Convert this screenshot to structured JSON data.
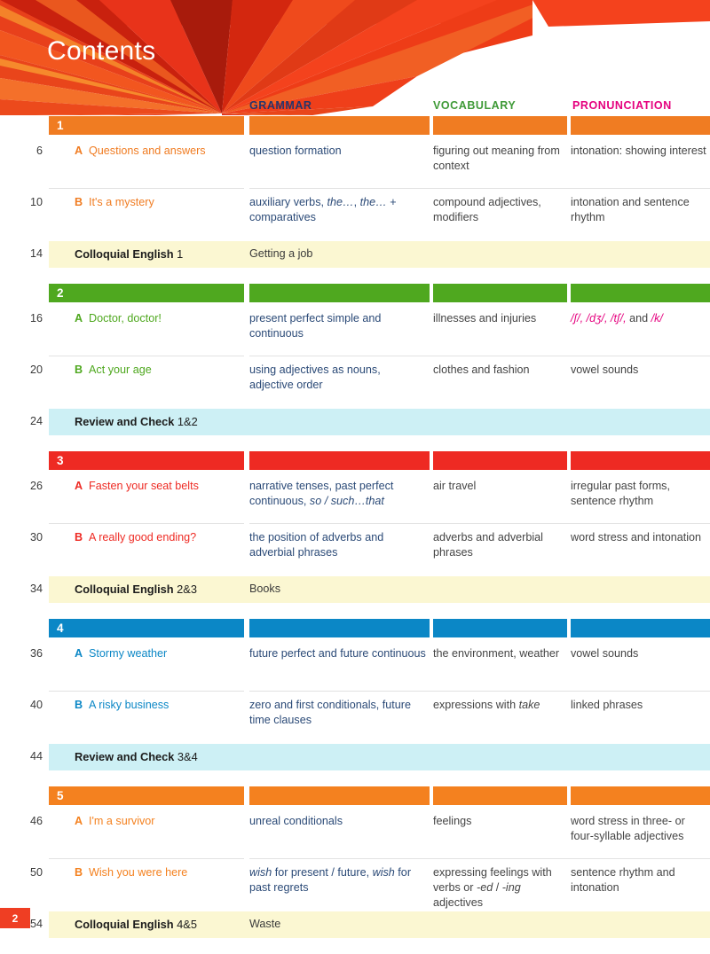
{
  "page": {
    "title": "Contents",
    "page_number": "2",
    "accent_red": "#ef3e23",
    "title_band_color": "#f4421d"
  },
  "columns": [
    {
      "label": "GRAMMAR",
      "color": "#26356b"
    },
    {
      "label": "VOCABULARY",
      "color": "#3f9a37"
    },
    {
      "label": "PRONUNCIATION",
      "color": "#e5007e"
    }
  ],
  "units": [
    {
      "number": "1",
      "color": "#f07c22",
      "lessons": [
        {
          "page": "6",
          "letter": "A",
          "title": "Questions and answers",
          "grammar": "question formation",
          "vocabulary": "figuring out meaning from context",
          "pronunciation": "intonation: showing interest"
        },
        {
          "page": "10",
          "letter": "B",
          "title": "It's a mystery",
          "grammar": "auxiliary verbs, <i>the…</i>, <i>the…</i> + comparatives",
          "vocabulary": "compound adjectives, modifiers",
          "pronunciation": "intonation and sentence rhythm"
        }
      ],
      "special": {
        "page": "14",
        "label": "<b>Colloquial English</b> 1",
        "extra": "Getting a job",
        "color": "#fbf7d2"
      }
    },
    {
      "number": "2",
      "color": "#4fa81f",
      "lessons": [
        {
          "page": "16",
          "letter": "A",
          "title": "Doctor, doctor!",
          "grammar": "present perfect simple and continuous",
          "vocabulary": "illnesses and injuries",
          "pronunciation": "<i style=\"color:#e5007e\">/ʃ/, /dʒ/, /tʃ/,</i> and <i style=\"color:#e5007e\">/k/</i>"
        },
        {
          "page": "20",
          "letter": "B",
          "title": "Act your age",
          "grammar": "using adjectives as nouns, adjective order",
          "vocabulary": "clothes and fashion",
          "pronunciation": "vowel sounds"
        }
      ],
      "special": {
        "page": "24",
        "label": "<b>Review and Check</b> 1&amp;2",
        "extra": "",
        "color": "#cdf0f5"
      }
    },
    {
      "number": "3",
      "color": "#ee2a23",
      "lessons": [
        {
          "page": "26",
          "letter": "A",
          "title": "Fasten your seat belts",
          "grammar": "narrative tenses, past perfect continuous, <i>so / such…that</i>",
          "vocabulary": "air travel",
          "pronunciation": "irregular past forms, sentence rhythm"
        },
        {
          "page": "30",
          "letter": "B",
          "title": "A really good ending?",
          "grammar": "the position of adverbs and adverbial phrases",
          "vocabulary": "adverbs and adverbial phrases",
          "pronunciation": "word stress and intonation"
        }
      ],
      "special": {
        "page": "34",
        "label": "<b>Colloquial English</b> 2&amp;3",
        "extra": "Books",
        "color": "#fbf7d2"
      }
    },
    {
      "number": "4",
      "color": "#0b87c6",
      "lessons": [
        {
          "page": "36",
          "letter": "A",
          "title": "Stormy weather",
          "grammar": "future perfect and future continuous",
          "vocabulary": "the environment, weather",
          "pronunciation": "vowel sounds"
        },
        {
          "page": "40",
          "letter": "B",
          "title": "A risky business",
          "grammar": "zero and first conditionals, future time clauses",
          "vocabulary": "expressions with <i>take</i>",
          "pronunciation": "linked phrases"
        }
      ],
      "special": {
        "page": "44",
        "label": "<b>Review and Check</b> 3&amp;4",
        "extra": "",
        "color": "#cdf0f5"
      }
    },
    {
      "number": "5",
      "color": "#f4811f",
      "lessons": [
        {
          "page": "46",
          "letter": "A",
          "title": "I'm a survivor",
          "grammar": "unreal conditionals",
          "vocabulary": "feelings",
          "pronunciation": "word stress in three- or four-syllable adjectives"
        },
        {
          "page": "50",
          "letter": "B",
          "title": "Wish you were here",
          "grammar": "<i>wish</i> for present / future, <i>wish</i> for past regrets",
          "vocabulary": "expressing feelings with verbs or <i>-ed</i> / <i>-ing</i> adjectives",
          "pronunciation": "sentence rhythm and intonation"
        }
      ],
      "special": {
        "page": "54",
        "label": "<b>Colloquial English</b> 4&amp;5",
        "extra": "Waste",
        "color": "#fbf7d2"
      }
    }
  ]
}
